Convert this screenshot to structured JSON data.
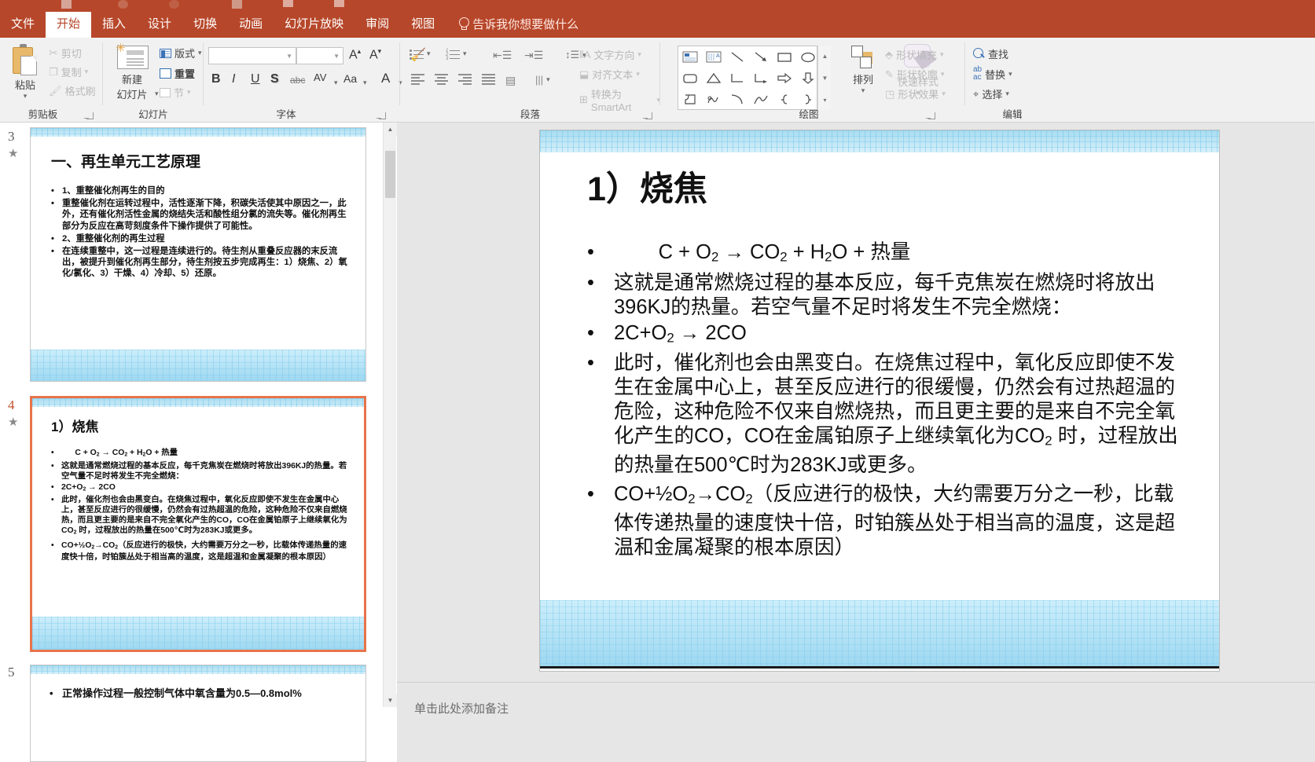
{
  "app": {
    "accent_color": "#b7472a",
    "qat_icons": [
      "save-icon",
      "undo-icon",
      "redo-icon",
      "start-slideshow-icon",
      "new-slide-icon",
      "present-icon"
    ]
  },
  "tabs": [
    {
      "label": "文件",
      "active": false
    },
    {
      "label": "开始",
      "active": true
    },
    {
      "label": "插入",
      "active": false
    },
    {
      "label": "设计",
      "active": false
    },
    {
      "label": "切换",
      "active": false
    },
    {
      "label": "动画",
      "active": false
    },
    {
      "label": "幻灯片放映",
      "active": false
    },
    {
      "label": "审阅",
      "active": false
    },
    {
      "label": "视图",
      "active": false
    }
  ],
  "tell_me": "告诉我你想要做什么",
  "ribbon": {
    "clipboard": {
      "group_label": "剪贴板",
      "paste": "粘贴",
      "cut": "剪切",
      "copy": "复制",
      "format_painter": "格式刷"
    },
    "slides": {
      "group_label": "幻灯片",
      "new_slide": "新建",
      "new_slide2": "幻灯片",
      "layout": "版式",
      "reset": "重置",
      "section": "节"
    },
    "font": {
      "group_label": "字体",
      "font_name_value": "",
      "font_size_value": "",
      "bold": "B",
      "italic": "I",
      "underline": "U",
      "shadow": "S",
      "strikethrough": "abc",
      "char_spacing": "AV",
      "change_case": "Aa",
      "font_color": "A",
      "grow_font": "A",
      "shrink_font": "A",
      "clear_formatting": "clear-formatting-icon"
    },
    "paragraph": {
      "group_label": "段落",
      "text_direction": "文字方向",
      "align_text": "对齐文本",
      "smartart": "转换为 SmartArt"
    },
    "drawing": {
      "group_label": "绘图",
      "arrange": "排列",
      "quick_styles": "快速样式",
      "shape_fill": "形状填充",
      "shape_outline": "形状轮廓",
      "shape_effects": "形状效果"
    },
    "editing": {
      "group_label": "编辑",
      "find": "查找",
      "replace": "替换",
      "select": "选择"
    }
  },
  "thumbnails": [
    {
      "number": "3",
      "has_animation_star": true,
      "selected": false,
      "title": "一、再生单元工艺原理",
      "bullets": [
        "1、重整催化剂再生的目的",
        "重整催化剂在运转过程中，活性逐渐下降，积碳失活使其中原因之一，此外，还有催化剂活性金属的烧结失活和酸性组分氯的流失等。催化剂再生部分为反应在高苛刻度条件下操作提供了可能性。",
        "2、重整催化剂的再生过程",
        "在连续重整中，这一过程是连续进行的。待生剂从重叠反应器的末反流出，被提升到催化剂再生部分，待生剂按五步完成再生：1）烧焦、2）氧化/氯化、3）干燥、4）冷却、5）还原。"
      ]
    },
    {
      "number": "4",
      "has_animation_star": true,
      "selected": true,
      "title": "1）烧焦",
      "bullets": [
        "        C + O2 → CO2 + H2O + 热量",
        "这就是通常燃烧过程的基本反应，每千克焦炭在燃烧时将放出396KJ的热量。若空气量不足时将发生不完全燃烧：",
        "2C+O2 → 2CO",
        "此时，催化剂也会由黑变白。在烧焦过程中，氧化反应即使不发生在金属中心上，甚至反应进行的很缓慢，仍然会有过热超温的危险，这种危险不仅来自燃烧热，而且更主要的是来自不完全氧化产生的CO，CO在金属铂原子上继续氧化为CO2 时，过程放出的热量在500℃时为283KJ或更多。",
        "CO+½O2→CO2（反应进行的极快，大约需要万分之一秒，比载体传递热量的速度快十倍，时铂簇丛处于相当高的温度，这是超温和金属凝聚的根本原因）"
      ]
    },
    {
      "number": "5",
      "has_animation_star": false,
      "selected": false,
      "title": "",
      "bullets": [
        "正常操作过程一般控制气体中氧含量为0.5—0.8mol%"
      ]
    }
  ],
  "slide": {
    "title": "1）烧焦",
    "bullets": [
      {
        "id": "eq1",
        "text": "C + O2 → CO2 + H2O + 热量"
      },
      {
        "id": "p1",
        "text": "这就是通常燃烧过程的基本反应，每千克焦炭在燃烧时将放出396KJ的热量。若空气量不足时将发生不完全燃烧："
      },
      {
        "id": "eq2",
        "text": "2C+O2 → 2CO"
      },
      {
        "id": "p2",
        "text": "此时，催化剂也会由黑变白。在烧焦过程中，氧化反应即使不发生在金属中心上，甚至反应进行的很缓慢，仍然会有过热超温的危险，这种危险不仅来自燃烧热，而且更主要的是来自不完全氧化产生的CO，CO在金属铂原子上继续氧化为CO2 时，过程放出的热量在500℃时为283KJ或更多。"
      },
      {
        "id": "p3",
        "text": "CO+½O2→CO2（反应进行的极快，大约需要万分之一秒，比载体传递热量的速度快十倍，时铂簇丛处于相当高的温度，这是超温和金属凝聚的根本原因）"
      }
    ]
  },
  "notes": {
    "placeholder": "单击此处添加备注"
  }
}
